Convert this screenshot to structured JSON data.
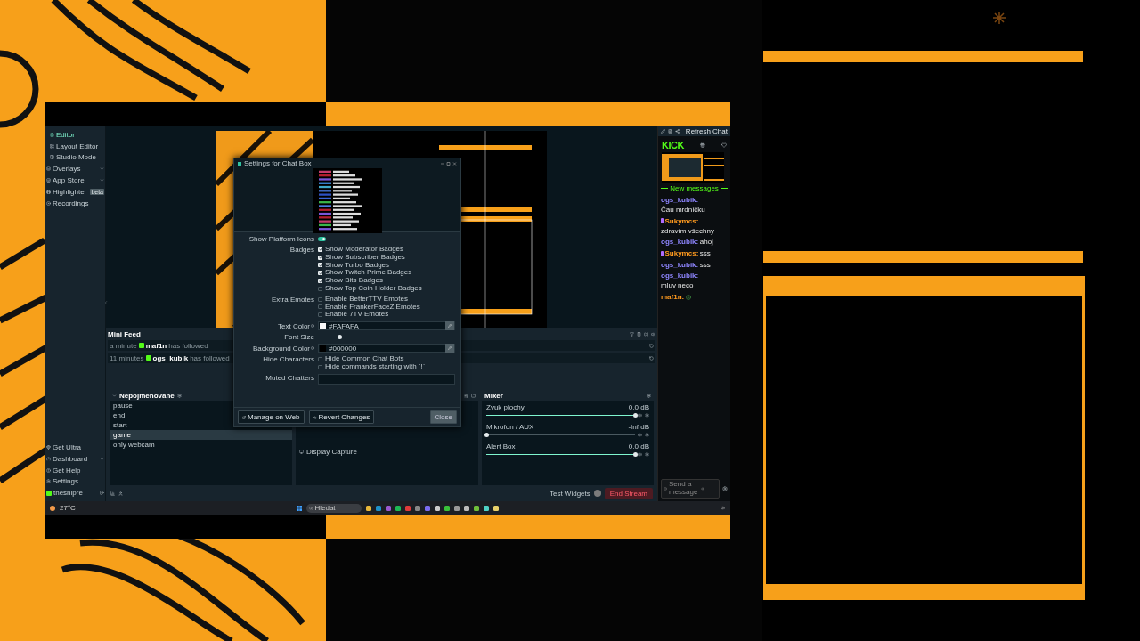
{
  "sidebar": {
    "items": [
      {
        "label": "Editor",
        "kind": "sub",
        "selected": true
      },
      {
        "label": "Layout Editor",
        "kind": "sub",
        "selected": false
      },
      {
        "label": "Studio Mode",
        "kind": "sub",
        "selected": false
      },
      {
        "label": "Overlays",
        "kind": "group",
        "selected": false
      },
      {
        "label": "App Store",
        "kind": "group",
        "selected": false
      },
      {
        "label": "Highlighter",
        "kind": "nav",
        "badge": "beta",
        "selected": false
      },
      {
        "label": "Recordings",
        "kind": "nav",
        "selected": false
      }
    ],
    "bottom_items": [
      {
        "label": "Get Ultra",
        "kind": "nav"
      },
      {
        "label": "Dashboard",
        "kind": "group"
      },
      {
        "label": "Get Help",
        "kind": "nav"
      },
      {
        "label": "Settings",
        "kind": "nav"
      }
    ],
    "account": "thesnipre"
  },
  "mini_feed": {
    "title": "Mini Feed",
    "events": [
      {
        "time": "a minute",
        "user": "maf1n",
        "action": "has followed"
      },
      {
        "time": "11 minutes",
        "user": "ogs_kubik",
        "action": "has followed"
      }
    ]
  },
  "scenes": {
    "title": "Nepojmenované",
    "items": [
      {
        "label": "pause",
        "selected": false
      },
      {
        "label": "end",
        "selected": false
      },
      {
        "label": "start",
        "selected": false
      },
      {
        "label": "game",
        "selected": true
      },
      {
        "label": "only webcam",
        "selected": false
      }
    ]
  },
  "sources": {
    "items": [
      {
        "label": "Display Capture"
      }
    ]
  },
  "mixer": {
    "title": "Mixer",
    "channels": [
      {
        "name": "Zvuk plochy",
        "reading": "0.0 dB",
        "level": 1
      },
      {
        "name": "Mikrofon / AUX",
        "reading": "-Inf dB",
        "level": 0
      },
      {
        "name": "Alert Box",
        "reading": "0.0 dB",
        "level": 1
      }
    ]
  },
  "footer": {
    "test_widgets": "Test Widgets",
    "end_stream": "End Stream"
  },
  "dialog": {
    "title": "Settings for Chat Box",
    "platform_icons": {
      "label": "Show Platform Icons",
      "on": true
    },
    "groups": [
      {
        "label": "Badges",
        "options": [
          {
            "label": "Show Moderator Badges",
            "checked": true
          },
          {
            "label": "Show Subscriber Badges",
            "checked": true
          },
          {
            "label": "Show Turbo Badges",
            "checked": true
          },
          {
            "label": "Show Twitch Prime Badges",
            "checked": true
          },
          {
            "label": "Show Bits Badges",
            "checked": true
          },
          {
            "label": "Show Top Coin Holder Badges",
            "checked": false
          }
        ]
      },
      {
        "label": "Extra Emotes",
        "options": [
          {
            "label": "Enable BetterTTV Emotes",
            "checked": false
          },
          {
            "label": "Enable FrankerFaceZ Emotes",
            "checked": false
          },
          {
            "label": "Enable 7TV Emotes",
            "checked": false
          }
        ]
      }
    ],
    "text_color": {
      "label": "Text Color",
      "value": "#FAFAFA"
    },
    "font_size": {
      "label": "Font Size",
      "level": 0.16
    },
    "background_color": {
      "label": "Background Color",
      "value": "#000000"
    },
    "hide_characters": {
      "label": "Hide Characters",
      "options": [
        {
          "label": "Hide Common Chat Bots",
          "checked": false
        },
        {
          "label": "Hide commands starting with `!`",
          "checked": false
        }
      ]
    },
    "muted_chatters": {
      "label": "Muted Chatters"
    },
    "buttons": {
      "manage": "Manage on Web",
      "revert": "Revert Changes",
      "close": "Close"
    }
  },
  "chat": {
    "refresh": "Refresh Chat",
    "logo": "KICK",
    "divider": "New messages",
    "messages": [
      {
        "user": "ogs_kubik:",
        "text": "Čau mrdníčku",
        "color": "#8f86ff",
        "badge": false
      },
      {
        "user": "Sukymcs:",
        "text": "zdravím všechny",
        "color": "#ff9a1f",
        "badge": true
      },
      {
        "user": "ogs_kubik:",
        "text": "ahoj",
        "color": "#8f86ff",
        "badge": false
      },
      {
        "user": "Sukymcs:",
        "text": "sss",
        "color": "#ff9a1f",
        "badge": true
      },
      {
        "user": "ogs_kubik:",
        "text": "sss",
        "color": "#8f86ff",
        "badge": false
      },
      {
        "user": "ogs_kubik:",
        "text": "mluv neco",
        "color": "#8f86ff",
        "badge": false
      },
      {
        "user": "maf1n:",
        "color": "#ff9a1f",
        "badge": false
      }
    ],
    "input": {
      "placeholder": "Send a message"
    }
  },
  "taskbar": {
    "weather": "27°C",
    "search": "Hledat"
  }
}
